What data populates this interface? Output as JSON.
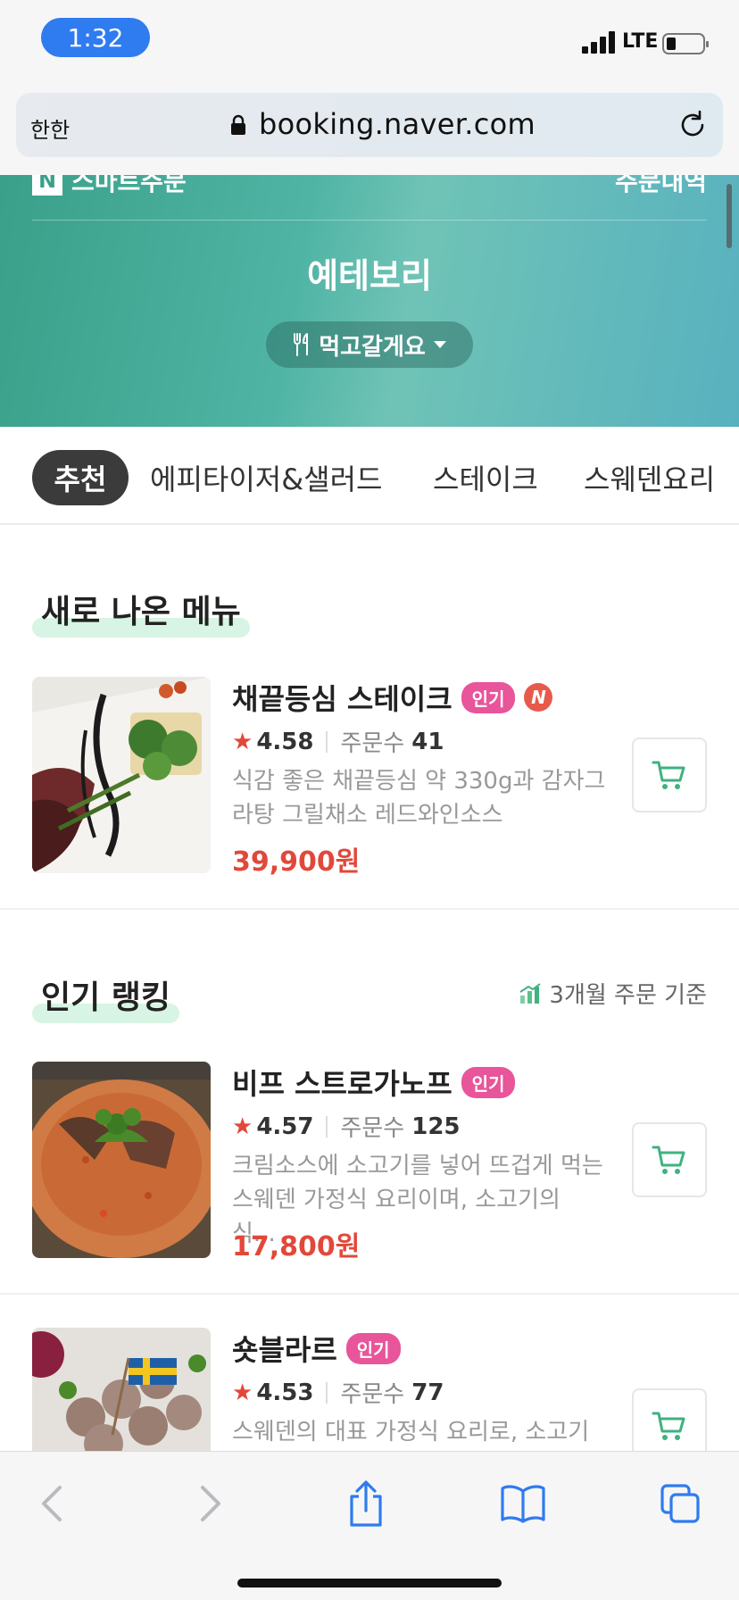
{
  "status": {
    "time": "1:32",
    "network": "LTE"
  },
  "browser": {
    "aa_label": "한한",
    "url": "booking.naver.com"
  },
  "hero": {
    "brand": "스마트주문",
    "orders_link": "주문내역",
    "shop_name": "예테보리",
    "mode_label": "먹고갈게요"
  },
  "tabs": [
    {
      "label": "추천"
    },
    {
      "label": "에피타이저&샐러드"
    },
    {
      "label": "스테이크"
    },
    {
      "label": "스웨덴요리"
    }
  ],
  "new_menu": {
    "title": "새로 나온 메뉴",
    "items": [
      {
        "name": "채끝등심 스테이크",
        "badge": "인기",
        "n_badge": "N",
        "rating": "4.58",
        "orders_label": "주문수",
        "orders": "41",
        "desc_line1": "식감 좋은 채끝등심 약 330g과 감자그",
        "desc_line2": "라탕 그릴채소 레드와인소스",
        "price": "39,900원"
      }
    ]
  },
  "ranking": {
    "title": "인기 랭킹",
    "basis": "3개월 주문 기준",
    "items": [
      {
        "name": "비프 스트로가노프",
        "badge": "인기",
        "rating": "4.57",
        "orders_label": "주문수",
        "orders": "125",
        "desc_line1": "크림소스에 소고기를 넣어 뜨겁게 먹는",
        "desc_line2": "스웨덴 가정식 요리이며, 소고기의 식...",
        "price": "17,800원"
      },
      {
        "name": "숏블라르",
        "badge": "인기",
        "rating": "4.53",
        "orders_label": "주문수",
        "orders": "77",
        "desc_line1": "스웨덴의 대표 가정식 요리로, 소고기와",
        "desc_line2": "",
        "price": ""
      }
    ]
  },
  "colors": {
    "accent_green": "#3fb27f",
    "price_red": "#e2483a",
    "popular_pink": "#e8559a",
    "ios_blue": "#2f7bf0"
  }
}
